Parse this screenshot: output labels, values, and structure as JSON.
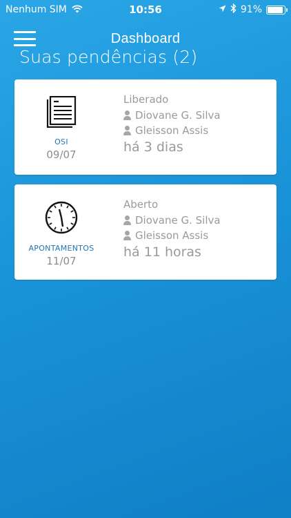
{
  "status_bar": {
    "carrier": "Nenhum SIM",
    "time": "10:56",
    "battery": "91%",
    "battery_level": 0.91,
    "icons": [
      "wifi-icon",
      "location-arrow-icon",
      "bluetooth-icon",
      "battery-icon"
    ]
  },
  "header": {
    "title": "Dashboard",
    "menu_icon": "hamburger-menu-icon"
  },
  "section": {
    "title": "Suas pendências (2)"
  },
  "cards": [
    {
      "icon": "document-list-icon",
      "type": "OSI",
      "date": "09/07",
      "status": "Liberado",
      "person1": "Diovane G. Silva",
      "person2": "Gleisson Assis",
      "elapsed": "há 3 dias"
    },
    {
      "icon": "clock-icon",
      "type": "APONTAMENTOS",
      "date": "11/07",
      "status": "Aberto",
      "person1": "Diovane G. Silva",
      "person2": "Gleisson Assis",
      "elapsed": "há 11 horas"
    }
  ],
  "colors": {
    "background": "#1a93d8",
    "accent": "#1f74b8",
    "muted_text": "#9a9a9a"
  }
}
